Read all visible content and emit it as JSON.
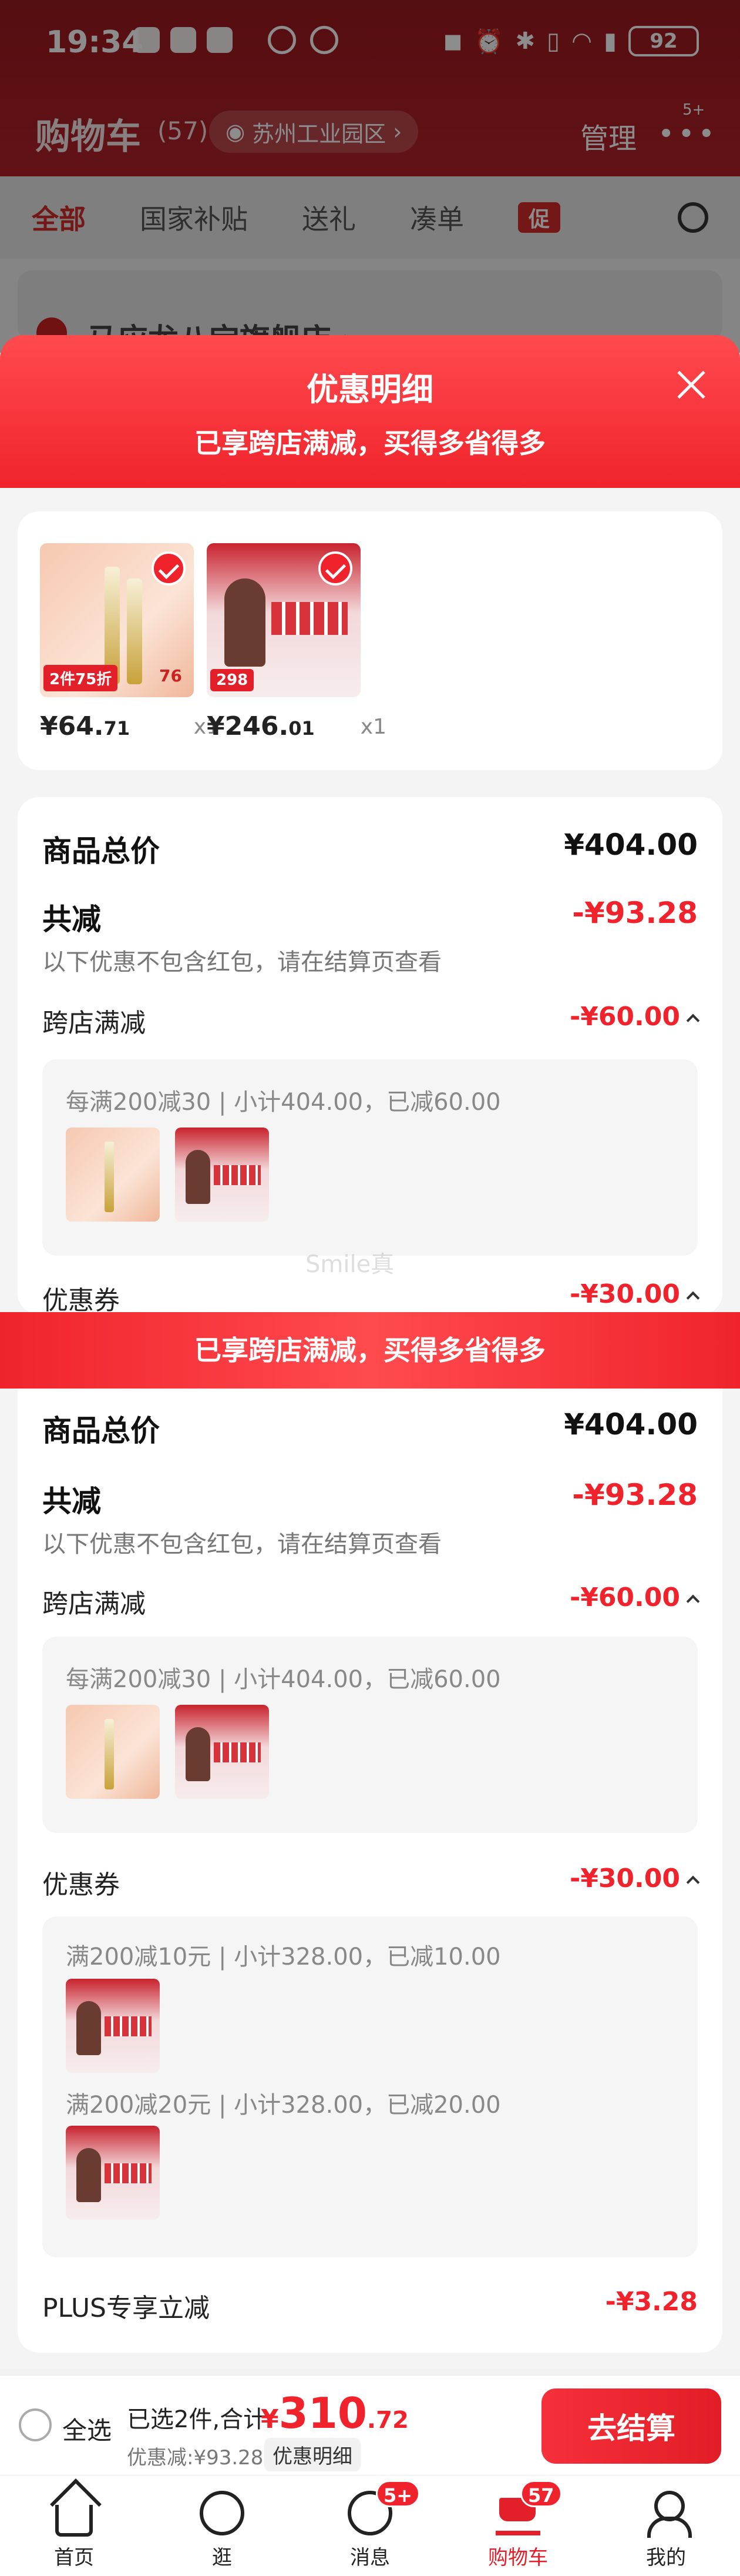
{
  "status_bar": {
    "time": "19:34",
    "battery": "92"
  },
  "header": {
    "title": "购物车",
    "count": "(57)",
    "location": "苏州工业园区",
    "location_arrow": "›",
    "manage": "管理",
    "more_badge": "5+"
  },
  "tabs": [
    "全部",
    "国家补贴",
    "送礼",
    "凑单"
  ],
  "tab_promo": "促",
  "shop_name": "马应龙八宝旗舰店 ›",
  "sheet": {
    "title": "优惠明细",
    "subtitle": "已享跨店满减，买得多省得多",
    "products": [
      {
        "price_int": "¥64.",
        "price_dec": "71",
        "qty": "x1",
        "tag": "2件75折",
        "tag_price": "76"
      },
      {
        "price_int": "¥246.",
        "price_dec": "01",
        "qty": "x1",
        "tag": "298"
      }
    ],
    "summary": {
      "total_label": "商品总价",
      "total_value": "¥404.00",
      "reduce_label": "共减",
      "reduce_value": "-¥93.28",
      "reduce_note": "以下优惠不包含红包，请在结算页查看",
      "cross_label": "跨店满减",
      "cross_value": "-¥60.00",
      "cross_detail": "每满200减30 | 小计404.00，已减60.00",
      "coupon_label": "优惠券",
      "coupon_value": "-¥30.00",
      "coupon_detail_1": "满200减10元 | 小计328.00，已减10.00",
      "coupon_detail_2": "满200减20元 | 小计328.00，已减20.00",
      "plus_label": "PLUS专享立减",
      "plus_value": "-¥3.28"
    },
    "watermark": "Smile真"
  },
  "checkout": {
    "select_all": "全选",
    "selected": "已选2件,合计:",
    "total_yen": "¥",
    "total_int": "310",
    "total_dec": ".72",
    "discount": "优惠减:¥93.28",
    "detail_btn": "优惠明细",
    "submit": "去结算"
  },
  "nav": [
    {
      "label": "首页",
      "icon": "home-icon"
    },
    {
      "label": "逛",
      "icon": "face-icon"
    },
    {
      "label": "消息",
      "icon": "chat-icon",
      "badge": "5+"
    },
    {
      "label": "购物车",
      "icon": "cart-icon",
      "badge": "57"
    },
    {
      "label": "我的",
      "icon": "user-icon"
    }
  ],
  "colors": {
    "accent": "#f0232c",
    "header_bg": "#b3222a"
  }
}
